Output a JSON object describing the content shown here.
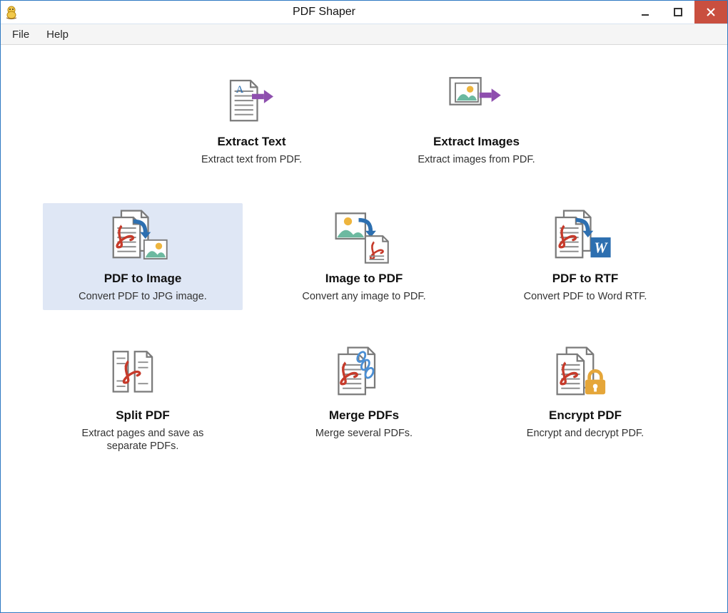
{
  "window": {
    "title": "PDF Shaper",
    "icon": "app-icon"
  },
  "menu": {
    "file": "File",
    "help": "Help"
  },
  "tiles": {
    "extract_text": {
      "title": "Extract Text",
      "desc": "Extract text from PDF."
    },
    "extract_images": {
      "title": "Extract Images",
      "desc": "Extract images from PDF."
    },
    "pdf_to_image": {
      "title": "PDF to Image",
      "desc": "Convert PDF to JPG image."
    },
    "image_to_pdf": {
      "title": "Image to PDF",
      "desc": "Convert any image to PDF."
    },
    "pdf_to_rtf": {
      "title": "PDF to RTF",
      "desc": "Convert PDF to Word RTF."
    },
    "split_pdf": {
      "title": "Split PDF",
      "desc": "Extract pages and save as separate PDFs."
    },
    "merge_pdfs": {
      "title": "Merge PDFs",
      "desc": "Merge several PDFs."
    },
    "encrypt_pdf": {
      "title": "Encrypt PDF",
      "desc": "Encrypt and decrypt PDF."
    }
  },
  "selected": "pdf_to_image",
  "colors": {
    "accent": "#2e79c2",
    "selection_bg": "#dfe7f5",
    "close_btn": "#c94f3f",
    "arrow": "#8e4fae",
    "pdf_red": "#c63a2a",
    "image_green": "#6cb9a0",
    "sun": "#eeb53e",
    "word_blue": "#2d6fb0",
    "lock": "#e5a639",
    "link_blue": "#4b8fd4"
  }
}
